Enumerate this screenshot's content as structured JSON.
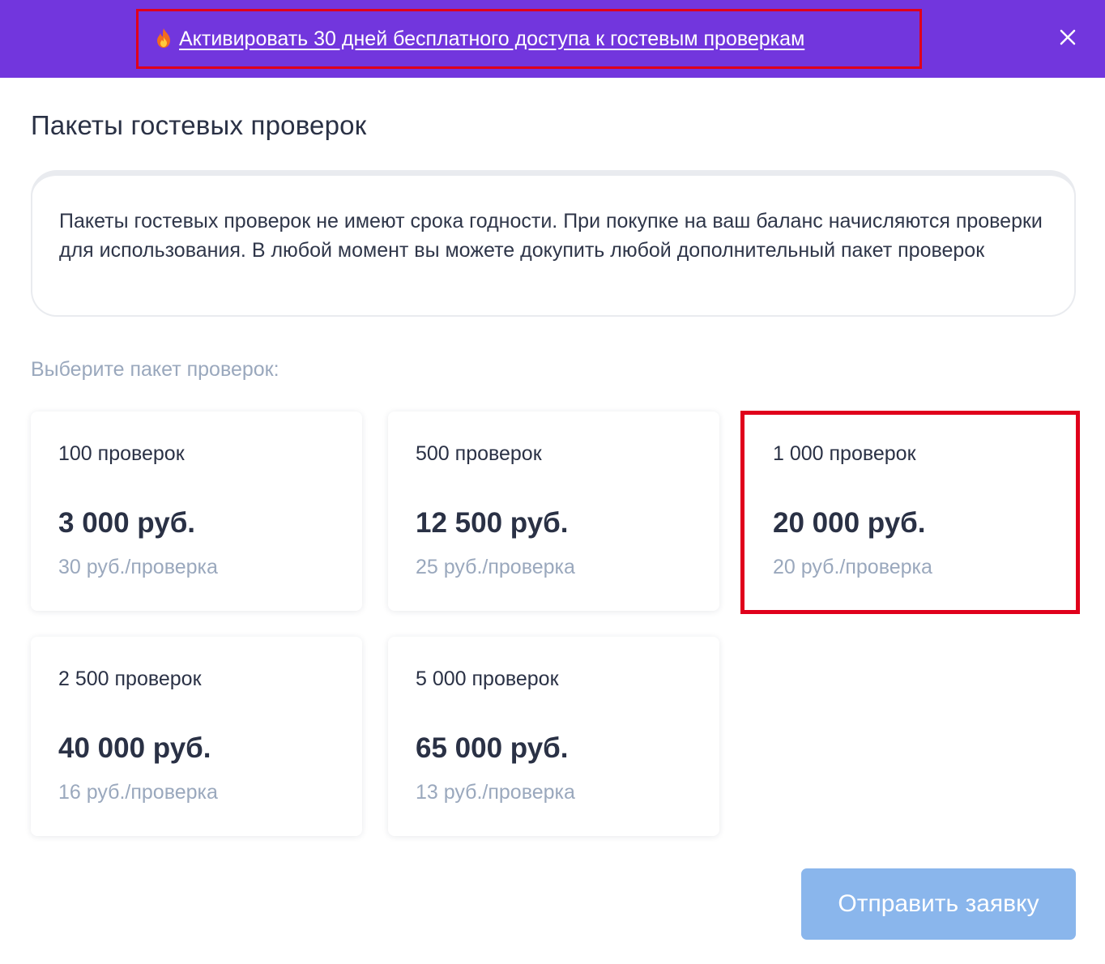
{
  "banner": {
    "link_text": "Активировать 30 дней бесплатного доступа к гостевым проверкам",
    "icon": "fire-icon",
    "close_icon": "close-icon",
    "background_color": "#7236dd"
  },
  "page": {
    "title": "Пакеты гостевых проверок",
    "info_text": "Пакеты гостевых проверок не имеют срока годности. При покупке на ваш баланс начисляются проверки для использования. В любой момент вы можете докупить любой дополнительный пакет проверок",
    "choose_label": "Выберите пакет проверок:"
  },
  "packages": [
    {
      "qty": "100 проверок",
      "price": "3 000 руб.",
      "unit": "30 руб./проверка",
      "selected": false
    },
    {
      "qty": "500 проверок",
      "price": "12 500 руб.",
      "unit": "25 руб./проверка",
      "selected": false
    },
    {
      "qty": "1 000 проверок",
      "price": "20 000 руб.",
      "unit": "20 руб./проверка",
      "selected": true
    },
    {
      "qty": "2 500 проверок",
      "price": "40 000 руб.",
      "unit": "16 руб./проверка",
      "selected": false
    },
    {
      "qty": "5 000 проверок",
      "price": "65 000 руб.",
      "unit": "13 руб./проверка",
      "selected": false
    }
  ],
  "submit": {
    "label": "Отправить заявку",
    "enabled": false,
    "color": "#8ab6ec"
  }
}
